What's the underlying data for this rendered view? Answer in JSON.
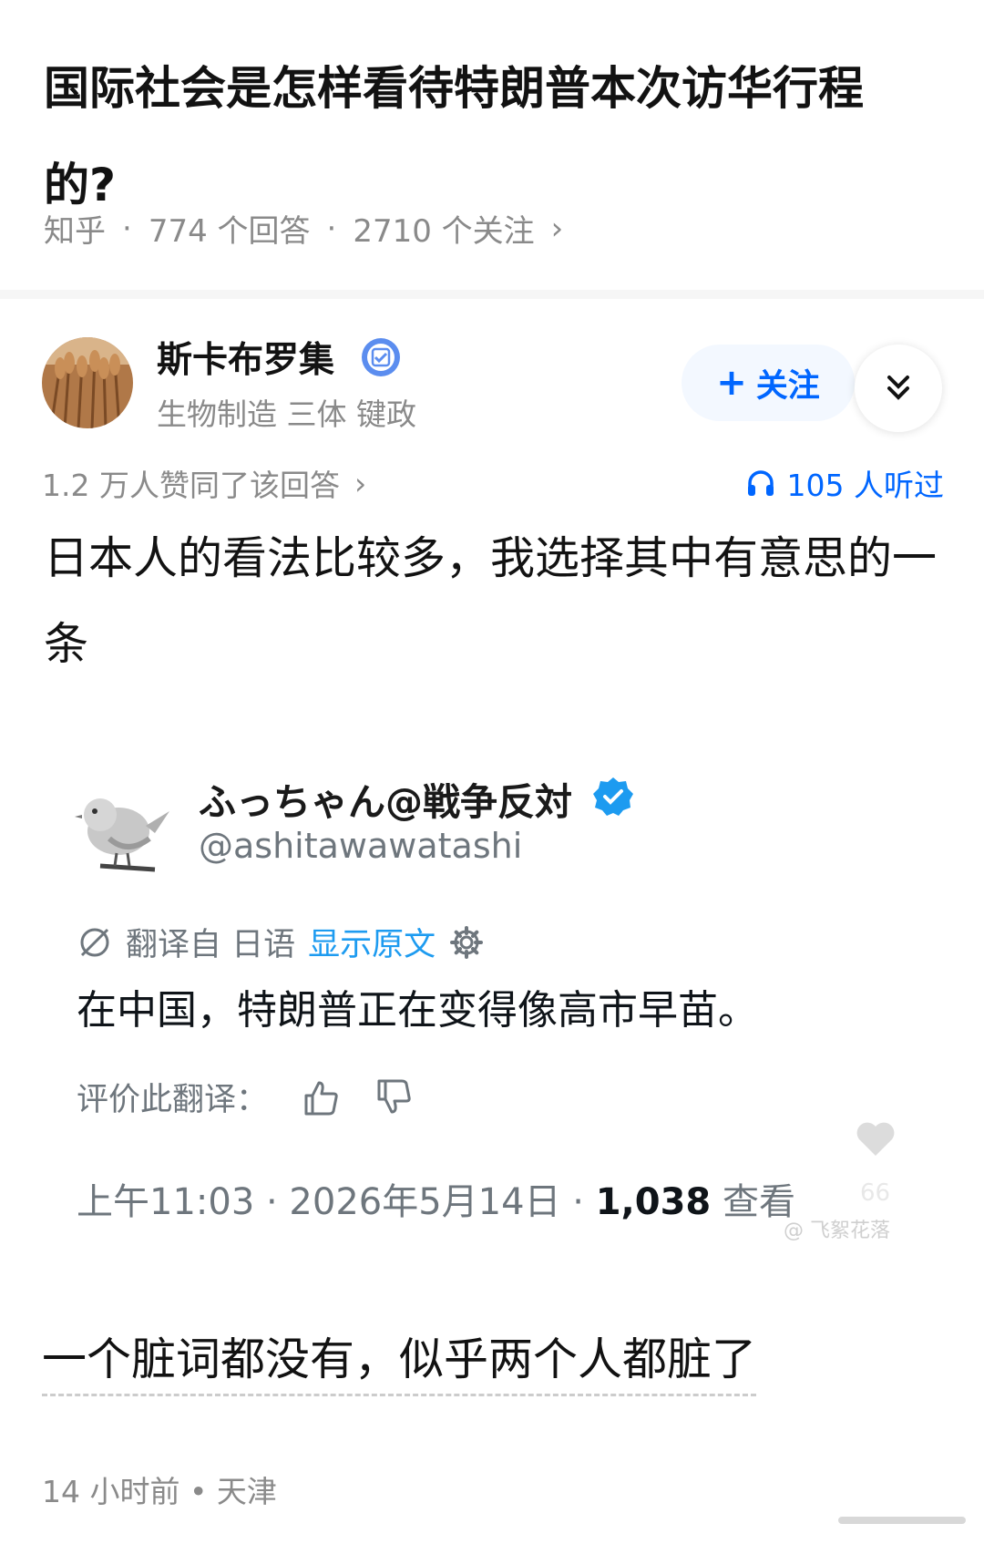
{
  "question": {
    "title": "国际社会是怎样看待特朗普本次访华行程的?",
    "source": "知乎",
    "answers": "774 个回答",
    "followers": "2710 个关注"
  },
  "author": {
    "name": "斯卡布罗集",
    "tags": "生物制造 三体 键政",
    "follow_label": "关注",
    "verified_icon": "verified-badge-icon"
  },
  "stats": {
    "agree_text": "1.2 万人赞同了该回答",
    "listen_text": "105 人听过"
  },
  "answer": {
    "body": "日本人的看法比较多，我选择其中有意思的一条",
    "remark": "一个脏词都没有，似乎两个人都脏了",
    "time_location": "14 小时前 • 天津"
  },
  "tweet": {
    "display_name": "ふっちゃん@戦争反対",
    "handle": "@ashitawawatashi",
    "translated_from": "翻译自 日语",
    "show_original": "显示原文",
    "text": "在中国，特朗普正在变得像高市早苗。",
    "rate_label": "评价此翻译：",
    "time_date": "上午11:03 · 2026年5月14日 · ",
    "views": "1,038",
    "views_label": " 查看"
  },
  "overlay": {
    "like_count": "66",
    "watermark": "@ 飞絮花落"
  },
  "colors": {
    "zhihu_blue": "#0066ff",
    "twitter_blue": "#1d9bf0",
    "muted": "#8a8a8a"
  }
}
